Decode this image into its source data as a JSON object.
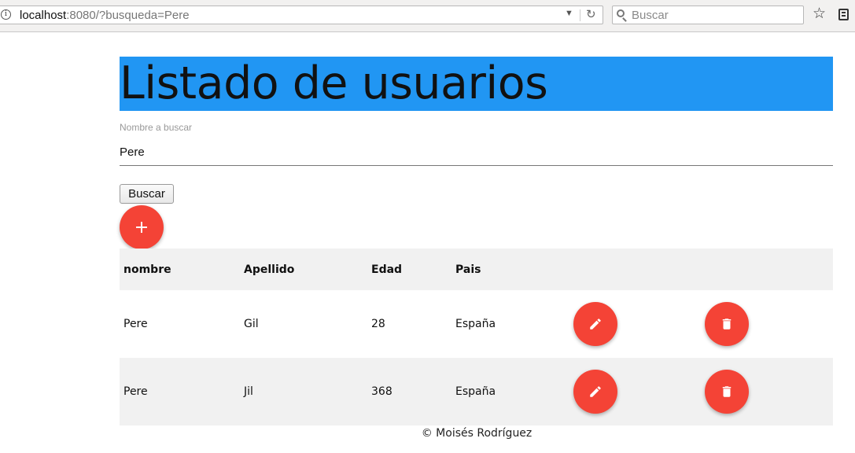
{
  "browser": {
    "url_host": "localhost",
    "url_rest": ":8080/?busqueda=Pere",
    "search_placeholder": "Buscar"
  },
  "page": {
    "title": "Listado de usuarios",
    "search_label": "Nombre a buscar",
    "search_value": "Pere",
    "search_button": "Buscar",
    "footer": "© Moisés Rodríguez"
  },
  "table": {
    "headers": [
      "nombre",
      "Apellido",
      "Edad",
      "Pais"
    ],
    "rows": [
      {
        "nombre": "Pere",
        "apellido": "Gil",
        "edad": "28",
        "pais": "España"
      },
      {
        "nombre": "Pere",
        "apellido": "Jil",
        "edad": "368",
        "pais": "España"
      }
    ]
  },
  "colors": {
    "header_bg": "#2196f3",
    "fab": "#f44336",
    "row_alt": "#f1f1f1"
  },
  "icons": {
    "add": "plus-icon",
    "edit": "pencil-icon",
    "delete": "trash-icon"
  }
}
